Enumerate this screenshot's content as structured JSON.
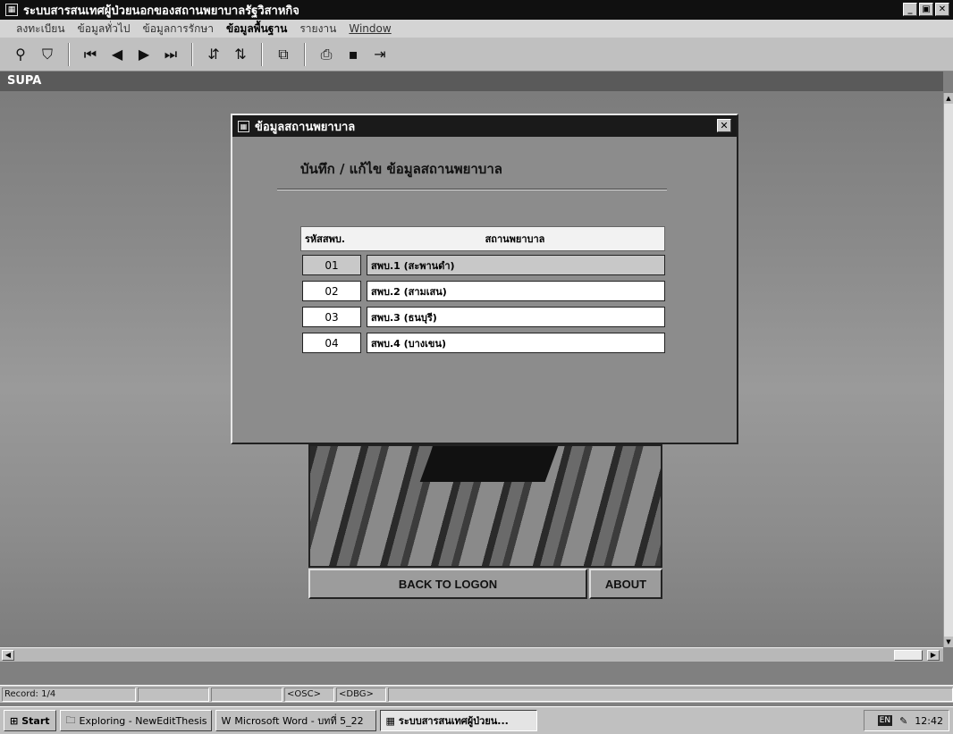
{
  "window": {
    "title": "ระบบสารสนเทศผู้ป่วยนอกของสถานพยาบาลรัฐวิสาหกิจ",
    "controls": [
      "_",
      "▣",
      "✕"
    ]
  },
  "menu": {
    "items": [
      "ลงทะเบียน",
      "ข้อมูลทั่วไป",
      "ข้อมูลการรักษา",
      "ข้อมูลพื้นฐาน",
      "รายงาน",
      "Window"
    ]
  },
  "mdi": {
    "child_title": "SUPA"
  },
  "dialog": {
    "title": "ข้อมูลสถานพยาบาล",
    "close": "✕",
    "heading": "บันทึก / แก้ไข ข้อมูลสถานพยาบาล",
    "grid": {
      "headers": {
        "code": "รหัสสพบ.",
        "name": "สถานพยาบาล"
      },
      "rows": [
        {
          "code": "01",
          "name": "สพบ.1 (สะพานดำ)"
        },
        {
          "code": "02",
          "name": "สพบ.2 (สามเสน)"
        },
        {
          "code": "03",
          "name": "สพบ.3 (ธนบุรี)"
        },
        {
          "code": "04",
          "name": "สพบ.4 (บางเขน)"
        }
      ]
    }
  },
  "main_buttons": {
    "back": "BACK TO LOGON",
    "about": "ABOUT"
  },
  "statusbar": {
    "record": "Record: 1/4",
    "osc": "<OSC>",
    "dbg": "<DBG>"
  },
  "taskbar": {
    "start": "Start",
    "tasks": [
      {
        "label": "Exploring - NewEditThesis"
      },
      {
        "label": "Microsoft Word - บทที่ 5_22"
      },
      {
        "label": "ระบบสารสนเทศผู้ป่วยน..."
      }
    ],
    "lang": "EN",
    "clock": "12:42"
  }
}
